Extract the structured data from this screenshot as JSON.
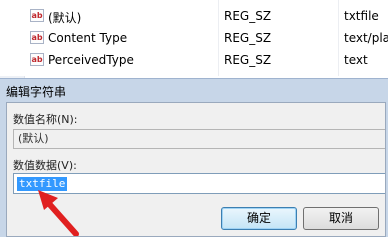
{
  "registry": {
    "rows": [
      {
        "icon": "ab",
        "name": "(默认)",
        "type": "REG_SZ",
        "data": "txtfile"
      },
      {
        "icon": "ab",
        "name": "Content Type",
        "type": "REG_SZ",
        "data": "text/pla"
      },
      {
        "icon": "ab",
        "name": "PerceivedType",
        "type": "REG_SZ",
        "data": "text"
      }
    ]
  },
  "dialog": {
    "title": "编辑字符串",
    "value_name_label": "数值名称(N):",
    "value_name": "(默认)",
    "value_data_label": "数值数据(V):",
    "value_data": "txtfile",
    "ok_label": "确定",
    "cancel_label": "取消"
  },
  "colors": {
    "selection": "#3399ff",
    "arrow": "#e02020"
  }
}
